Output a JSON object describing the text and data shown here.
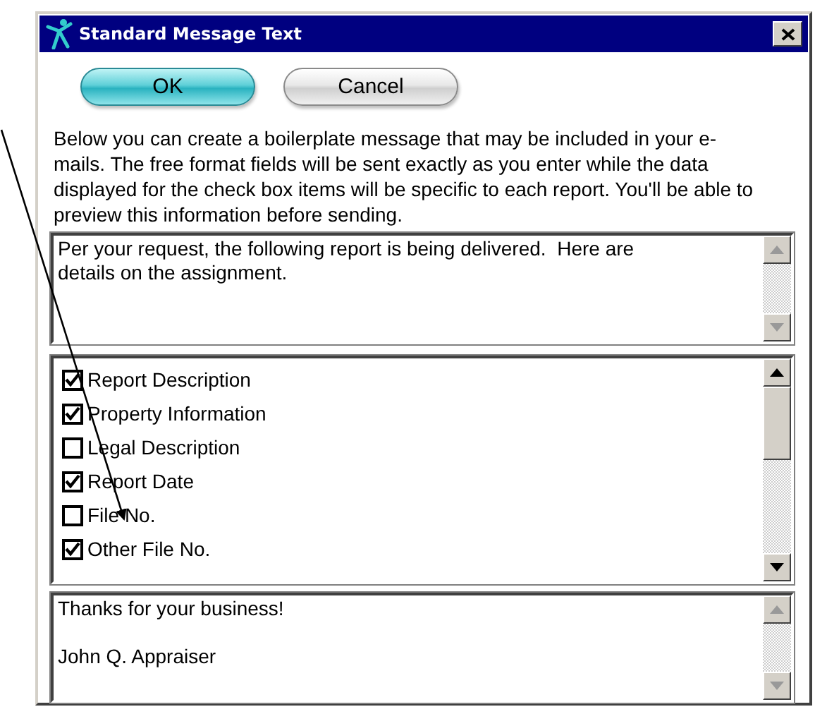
{
  "window": {
    "title": "Standard Message Text"
  },
  "buttons": [
    {
      "label": "OK",
      "kind": "primary"
    },
    {
      "label": "Cancel",
      "kind": "secondary"
    }
  ],
  "instructions": "Below you can create a boilerplate message that may be included in your e-mails. The free format fields will be sent exactly as you enter while the data displayed for the check box items will be specific to each report. You'll be able to preview this information before sending.",
  "header_message": {
    "value": "Per your request, the following report is being delivered.  Here are details on the assignment."
  },
  "items": [
    {
      "label": "Report Description",
      "checked": true
    },
    {
      "label": "Property Information",
      "checked": true
    },
    {
      "label": "Legal Description",
      "checked": false
    },
    {
      "label": "Report Date",
      "checked": true
    },
    {
      "label": "File No.",
      "checked": false
    },
    {
      "label": "Other File No.",
      "checked": true
    }
  ],
  "footer_message": {
    "value": "Thanks for your business!\n\nJohn Q. Appraiser"
  }
}
